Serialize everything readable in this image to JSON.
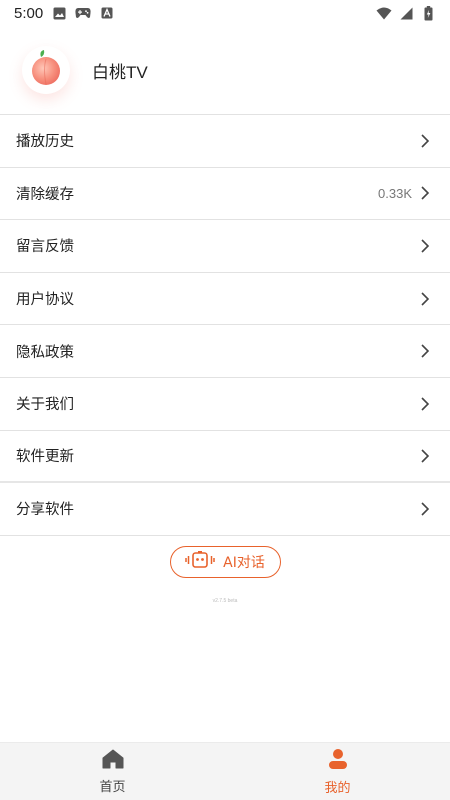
{
  "status_bar": {
    "time": "5:00",
    "icons_left": [
      "image-icon",
      "gamepad-icon",
      "font-icon"
    ],
    "icons_right": [
      "wifi-icon",
      "signal-icon",
      "battery-icon"
    ]
  },
  "header": {
    "app_name": "白桃TV",
    "logo": "peach-icon"
  },
  "menu": {
    "items": [
      {
        "label": "播放历史",
        "value": ""
      },
      {
        "label": "清除缓存",
        "value": "0.33K"
      },
      {
        "label": "留言反馈",
        "value": ""
      },
      {
        "label": "用户协议",
        "value": ""
      },
      {
        "label": "隐私政策",
        "value": ""
      },
      {
        "label": "关于我们",
        "value": ""
      },
      {
        "label": "软件更新",
        "value": ""
      },
      {
        "label": "分享软件",
        "value": ""
      }
    ]
  },
  "ai_button": {
    "label": "AI对话",
    "icon": "robot-icon"
  },
  "version_text": "v2.7.5 beta",
  "bottom_nav": {
    "items": [
      {
        "label": "首页",
        "icon": "home-icon",
        "active": false
      },
      {
        "label": "我的",
        "icon": "user-icon",
        "active": true
      }
    ]
  },
  "colors": {
    "accent": "#e8622c",
    "divider": "#e2e2e2",
    "nav_bg": "#f4f4f4"
  }
}
